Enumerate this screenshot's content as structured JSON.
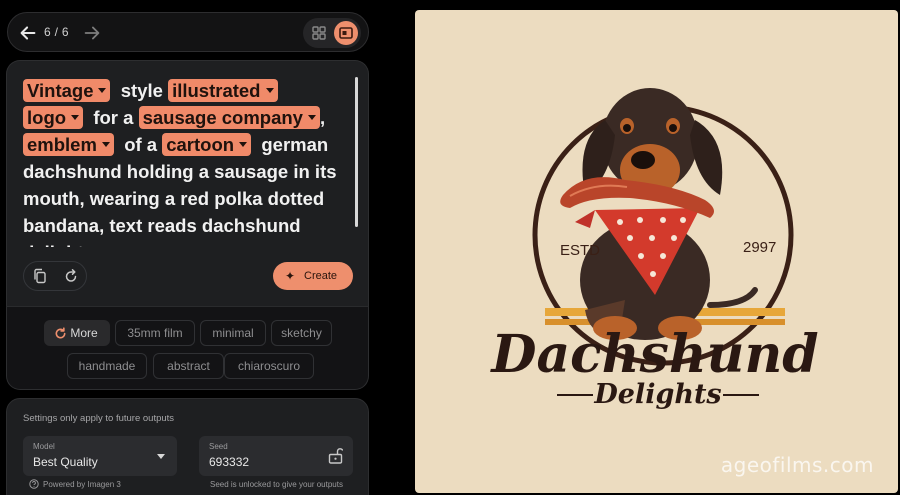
{
  "nav": {
    "counter": "6 / 6"
  },
  "prompt": {
    "chips": [
      "Vintage",
      "illustrated",
      "logo",
      "sausage company",
      "emblem",
      "cartoon"
    ],
    "words": [
      "style",
      "for a",
      ",",
      "of a",
      "german",
      "dachshund holding a sausage in its",
      "mouth, wearing a red polka dotted",
      "bandana, text reads dachshund",
      "delights"
    ]
  },
  "actions": {
    "create_label": "Create"
  },
  "suggestions": {
    "more_label": "More",
    "items": [
      "35mm film",
      "minimal",
      "sketchy",
      "handmade",
      "abstract",
      "chiaroscuro"
    ]
  },
  "settings": {
    "note": "Settings only apply to future outputs",
    "model_label": "Model",
    "model_value": "Best Quality",
    "seed_label": "Seed",
    "seed_value": "693332",
    "powered_by": "Powered by Imagen 3",
    "seed_note": "Seed is unlocked to give your outputs"
  },
  "image": {
    "estd": "ESTD",
    "year": "2997",
    "title": "Dachshund",
    "subtitle": "Delights",
    "watermark": "ageofilms.com"
  },
  "colors": {
    "accent": "#ee8f6d",
    "panel": "#1e1f21",
    "image_bg": "#ecdcc0"
  },
  "icons": [
    "arrow-left-icon",
    "arrow-right-icon",
    "grid-icon",
    "single-view-icon",
    "copy-icon",
    "reset-icon",
    "sparkle-icon",
    "refresh-icon",
    "chevron-down-icon",
    "lock-open-icon",
    "help-icon"
  ]
}
